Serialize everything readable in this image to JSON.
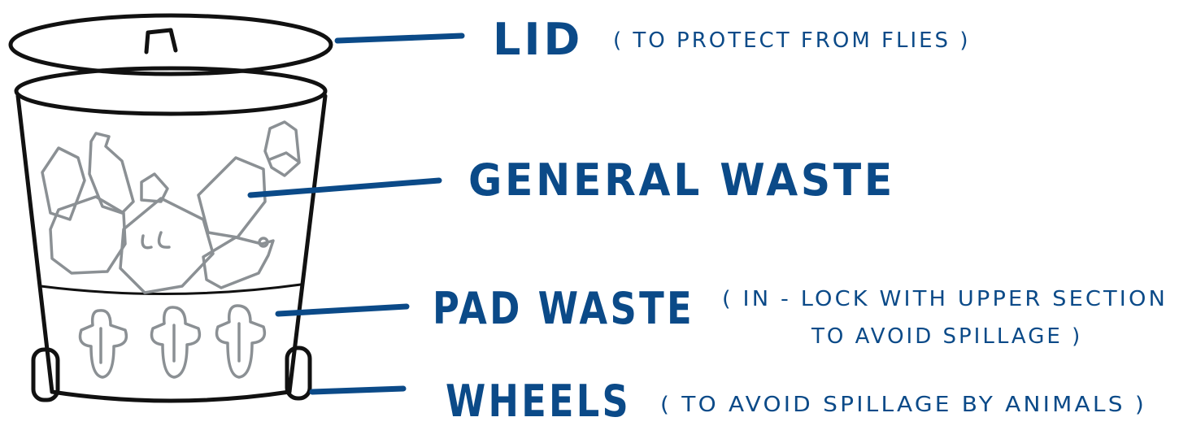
{
  "labels": {
    "lid": {
      "title": "LID",
      "note": "( TO PROTECT FROM FLIES )"
    },
    "general": {
      "title": "GENERAL WASTE"
    },
    "pad": {
      "title": "PAD WASTE",
      "note_line1": "( IN - LOCK WITH UPPER SECTION",
      "note_line2": "TO AVOID SPILLAGE )"
    },
    "wheels": {
      "title": "WHEELS",
      "note": "( TO AVOID SPILLAGE BY ANIMALS )"
    }
  },
  "colors": {
    "ink": "#111111",
    "label": "#0b4a88",
    "contents": "#8b9094"
  }
}
